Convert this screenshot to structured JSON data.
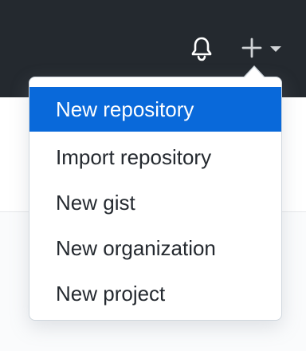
{
  "header": {
    "background": "#24292f",
    "notifications_icon": "bell-icon",
    "create_icon": "plus-icon",
    "create_caret_icon": "caret-down-icon"
  },
  "dropdown": {
    "items": [
      {
        "label": "New repository",
        "active": true
      },
      {
        "label": "Import repository",
        "active": false
      },
      {
        "label": "New gist",
        "active": false
      },
      {
        "label": "New organization",
        "active": false
      },
      {
        "label": "New project",
        "active": false
      }
    ]
  },
  "colors": {
    "accent": "#0969da",
    "text": "#24292f",
    "border": "#d0d7de"
  }
}
